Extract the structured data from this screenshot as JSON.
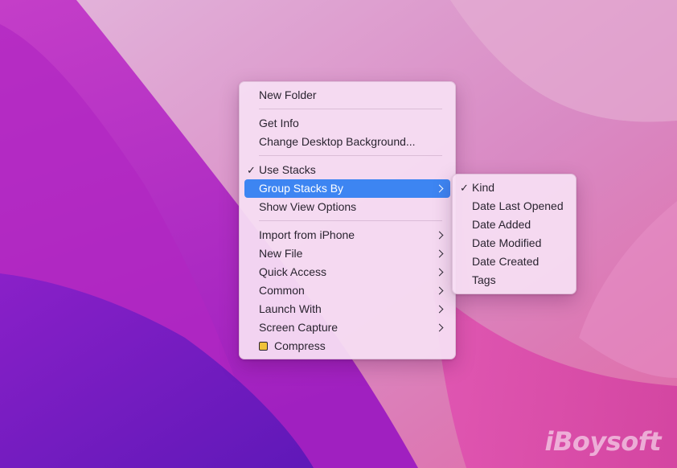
{
  "colors": {
    "highlight": "#3d85f2",
    "menu_bg": "#f6def3",
    "text": "#2a2430"
  },
  "context_menu": {
    "groups": [
      [
        {
          "label": "New Folder"
        }
      ],
      [
        {
          "label": "Get Info"
        },
        {
          "label": "Change Desktop Background..."
        }
      ],
      [
        {
          "label": "Use Stacks",
          "checked": true
        },
        {
          "label": "Group Stacks By",
          "submenu": true,
          "highlighted": true
        },
        {
          "label": "Show View Options"
        }
      ],
      [
        {
          "label": "Import from iPhone",
          "submenu": true
        },
        {
          "label": "New File",
          "submenu": true
        },
        {
          "label": "Quick Access",
          "submenu": true
        },
        {
          "label": "Common",
          "submenu": true
        },
        {
          "label": "Launch With",
          "submenu": true
        },
        {
          "label": "Screen Capture",
          "submenu": true
        },
        {
          "label": "Compress",
          "icon": "app-icon"
        }
      ]
    ]
  },
  "group_stacks_submenu": {
    "items": [
      {
        "label": "Kind",
        "checked": true
      },
      {
        "label": "Date Last Opened"
      },
      {
        "label": "Date Added"
      },
      {
        "label": "Date Modified"
      },
      {
        "label": "Date Created"
      },
      {
        "label": "Tags"
      }
    ]
  },
  "watermark": "iBoysoft",
  "check_glyph": "✓"
}
